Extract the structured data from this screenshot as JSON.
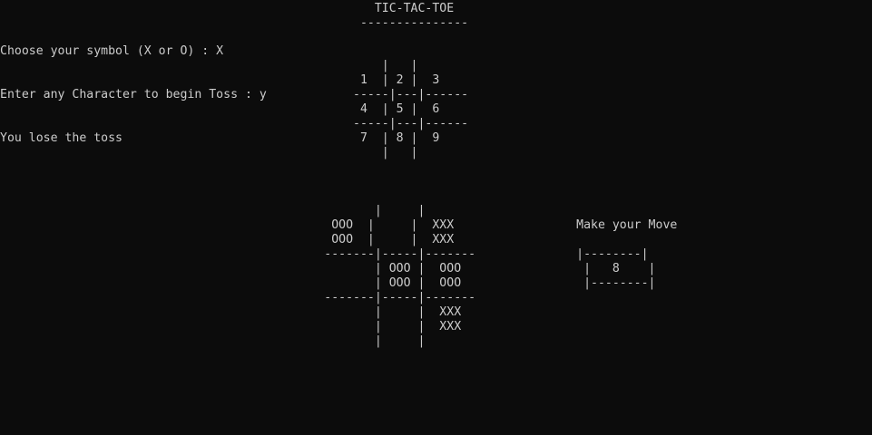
{
  "console": {
    "lines": [
      "                                                    TIC-TAC-TOE",
      "                                                  ---------------",
      "",
      "Choose your symbol (X or O) : X",
      "                                                     |   |",
      "                                                  1  | 2 |  3",
      "Enter any Character to begin Toss : y            -----|---|------",
      "                                                  4  | 5 |  6",
      "                                                 -----|---|------",
      "You lose the toss                                 7  | 8 |  9",
      "                                                     |   |",
      "",
      "",
      "                                                    |     |",
      "                                              OOO  |     |  XXX                 Make your Move",
      "                                              OOO  |     |  XXX",
      "                                             -------|-----|-------              |--------|",
      "                                                    | OOO |  OOO                 |   8    |",
      "                                                    | OOO |  OOO                 |--------|",
      "                                             -------|-----|-------",
      "                                                    |     |  XXX",
      "                                                    |     |  XXX",
      "                                                    |     |"
    ]
  }
}
